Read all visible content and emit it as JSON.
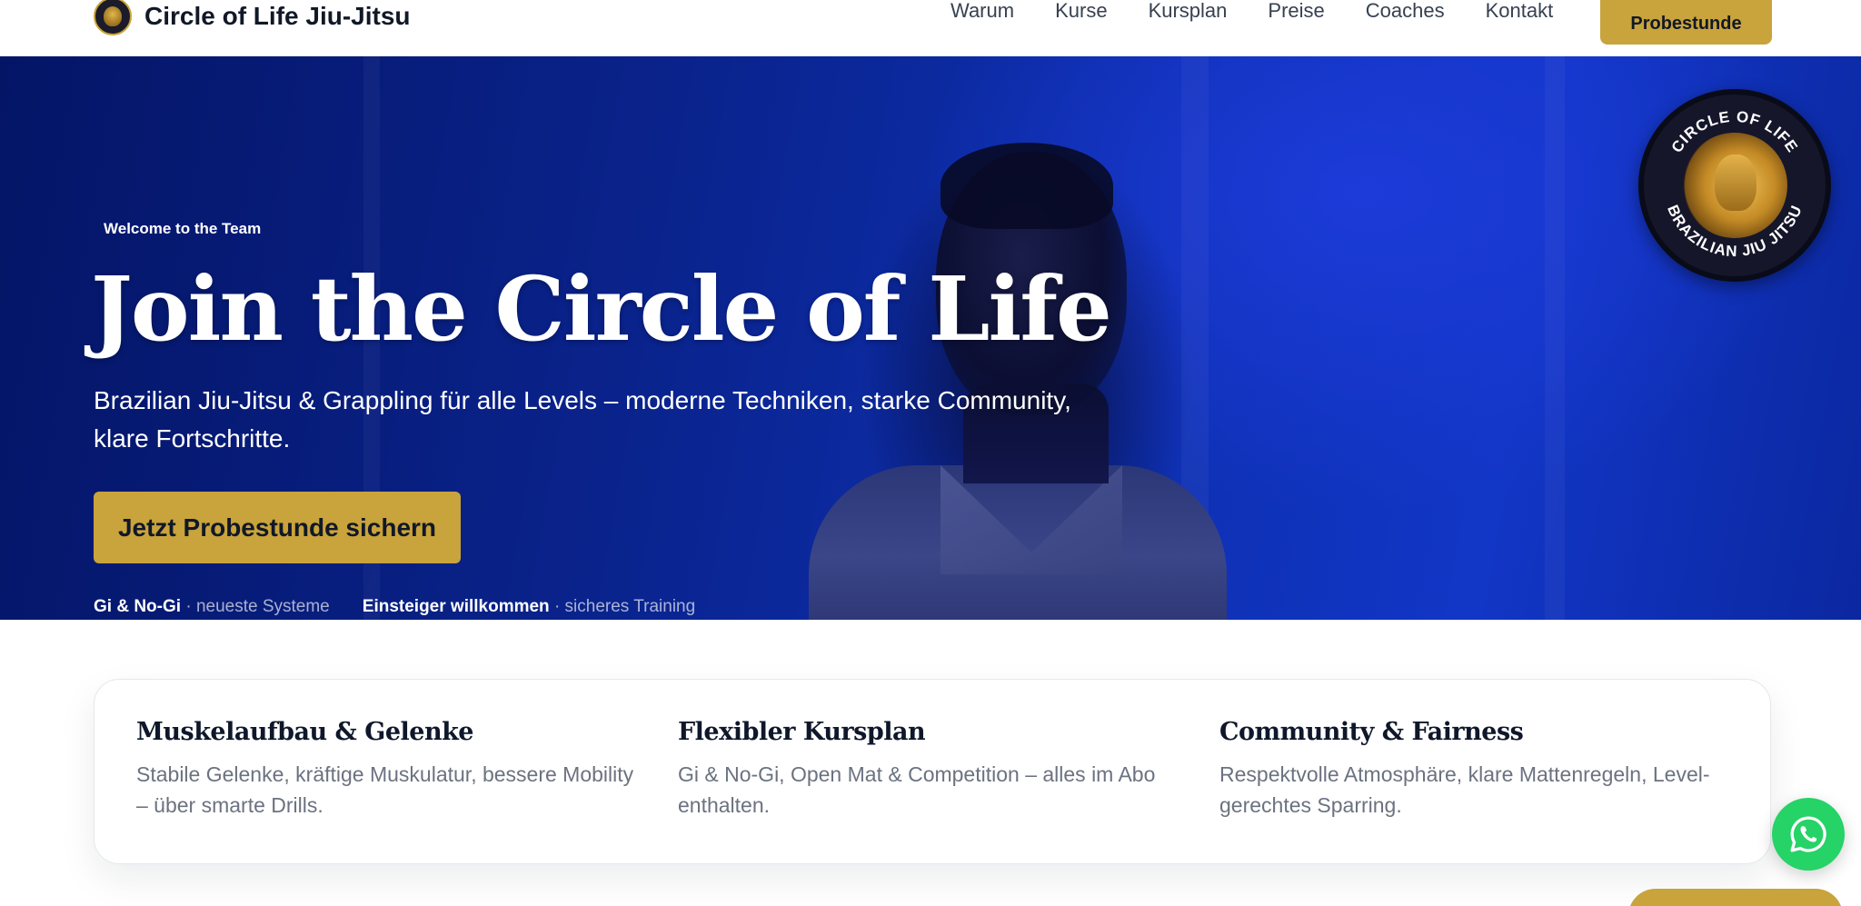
{
  "header": {
    "brand_name": "Circle of Life Jiu-Jitsu",
    "nav": [
      "Warum",
      "Kurse",
      "Kursplan",
      "Preise",
      "Coaches",
      "Kontakt"
    ],
    "cta_label": "Probestunde"
  },
  "hero": {
    "eyebrow": "Welcome to the Team",
    "title": "Join the Circle of Life",
    "subtitle": "Brazilian Jiu-Jitsu & Grappling für alle Levels – moderne Techniken, starke Community, klare Fortschritte.",
    "cta_label": "Jetzt Probestunde sichern",
    "features": [
      {
        "strong": "Gi & No-Gi",
        "rest": " · neueste Systeme"
      },
      {
        "strong": "Einsteiger willkommen",
        "rest": " · sicheres Training"
      }
    ],
    "badge": {
      "top_text": "CIRCLE OF LIFE",
      "bottom_text": "BRAZILIAN JIU JITSU"
    }
  },
  "features": [
    {
      "title": "Muskelaufbau & Gelenke",
      "text": "Stabile Gelenke, kräftige Muskulatur, bessere Mobility – über smarte Drills."
    },
    {
      "title": "Flexibler Kursplan",
      "text": "Gi & No-Gi, Open Mat & Competition – alles im Abo enthalten."
    },
    {
      "title": "Community & Fairness",
      "text": "Respektvolle Atmosphäre, klare Mattenregeln, Level-gerechtes Sparring."
    }
  ],
  "colors": {
    "accent_gold": "#c9a33b",
    "hero_blue": "#0d2fb0",
    "whatsapp_green": "#25d366"
  },
  "icons": {
    "whatsapp": "whatsapp-icon",
    "brand": "lion-logo-icon"
  }
}
